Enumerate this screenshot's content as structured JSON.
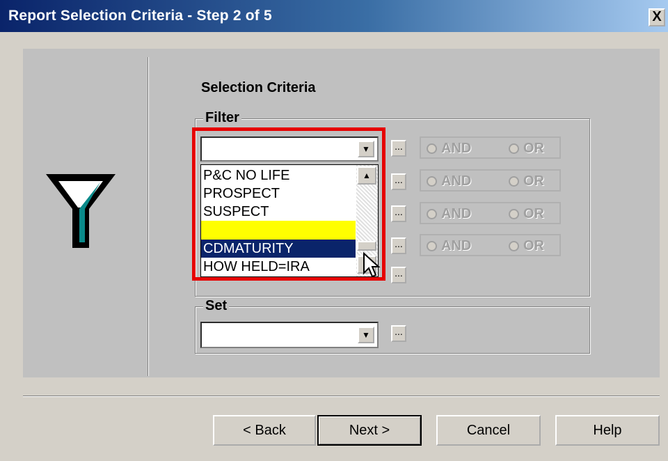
{
  "window": {
    "title": "Report Selection Criteria - Step 2 of 5",
    "close_label": "X"
  },
  "logo": {
    "icon": "funnel-icon"
  },
  "criteria": {
    "section_title": "Selection Criteria",
    "filter": {
      "legend": "Filter",
      "combo_value": "",
      "dropdown_items": [
        "P&C NO LIFE",
        "PROSPECT",
        "SUSPECT",
        "",
        "CDMATURITY",
        "HOW HELD=IRA"
      ],
      "selected_item": "CDMATURITY",
      "dots_label": "...",
      "and_label": "AND",
      "or_label": "OR"
    },
    "set": {
      "legend": "Set",
      "combo_value": "",
      "dots_label": "..."
    }
  },
  "buttons": {
    "back": "< Back",
    "next": "Next >",
    "cancel": "Cancel",
    "help": "Help"
  },
  "colors": {
    "highlight": "#e60000",
    "selected": "#0a246a",
    "yellow_row": "#ffff00"
  }
}
